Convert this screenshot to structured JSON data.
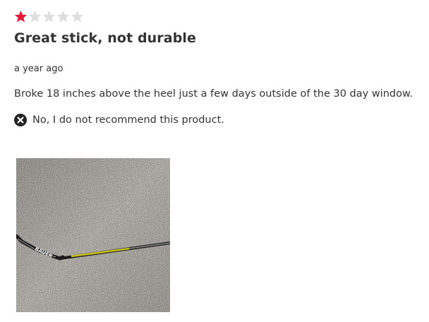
{
  "review": {
    "rating": 1,
    "max_rating": 5,
    "title": "Great stick, not durable",
    "date": "a year ago",
    "text": "Broke 18 inches above the heel just a few days outside of the 30 day window.",
    "recommendation": "No, I do not recommend this product.",
    "recommend_icon": "x-circle-icon",
    "star_filled_color": "#e31837",
    "star_empty_color": "#dddddd"
  },
  "photo": {
    "brand_text": "BAUER",
    "stick_accent_color": "#c8c21a"
  }
}
